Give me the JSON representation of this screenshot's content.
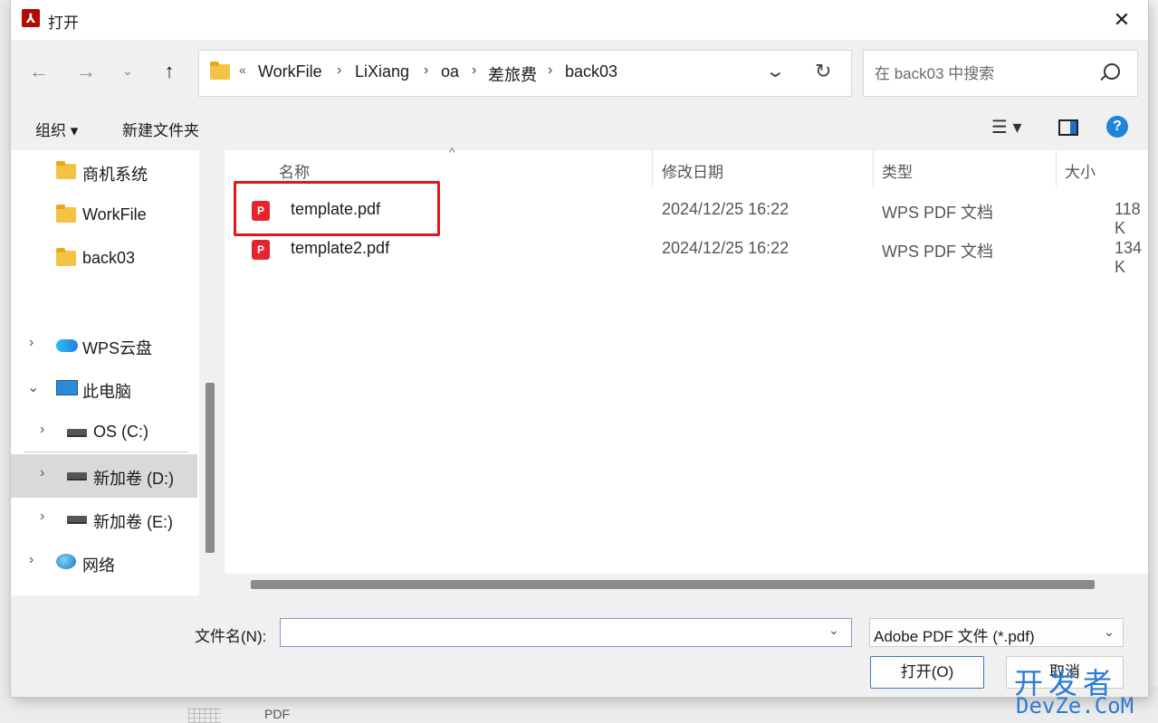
{
  "background": {
    "pdf_label": "PDF"
  },
  "dialog": {
    "title": "打开",
    "close_icon": "✕"
  },
  "nav": {
    "back_icon": "←",
    "forward_icon": "→",
    "recent_icon": "⌄",
    "up_icon": "↑"
  },
  "address": {
    "overflow": "«",
    "crumbs": [
      "WorkFile",
      "LiXiang",
      "oa",
      "差旅费",
      "back03"
    ],
    "separator": "›"
  },
  "search": {
    "placeholder": "在 back03 中搜索"
  },
  "toolbar": {
    "organize_label": "组织 ▾",
    "new_folder_label": "新建文件夹",
    "view_icon": "☰ ▾",
    "help_icon": "?"
  },
  "sidebar": {
    "quick_access": [
      {
        "label": "商机系统"
      },
      {
        "label": "WorkFile"
      },
      {
        "label": "back03"
      }
    ],
    "tree": [
      {
        "label": "WPS云盘",
        "arrow": "›"
      },
      {
        "label": "此电脑",
        "arrow": "⌄"
      },
      {
        "label": "OS (C:)",
        "arrow": "›"
      },
      {
        "label": "新加卷 (D:)",
        "arrow": "›"
      },
      {
        "label": "新加卷 (E:)",
        "arrow": "›"
      },
      {
        "label": "网络",
        "arrow": "›"
      }
    ]
  },
  "columns": {
    "name": "名称",
    "modified": "修改日期",
    "type": "类型",
    "size": "大小"
  },
  "files": [
    {
      "name": "template.pdf",
      "modified": "2024/12/25 16:22",
      "type": "WPS PDF 文档",
      "size": "118 K"
    },
    {
      "name": "template2.pdf",
      "modified": "2024/12/25 16:22",
      "type": "WPS PDF 文档",
      "size": "134 K"
    }
  ],
  "footer": {
    "filename_label": "文件名(N):",
    "filename_value": "",
    "filetype": "Adobe PDF 文件 (*.pdf)",
    "open_label": "打开(O)",
    "cancel_label": "取消"
  },
  "watermark": {
    "top": "开发者",
    "bottom": "DevZe.CoM"
  },
  "colors": {
    "highlight": "#e4141b",
    "accent": "#1f6fc5",
    "pdf_icon": "#e6232f"
  }
}
